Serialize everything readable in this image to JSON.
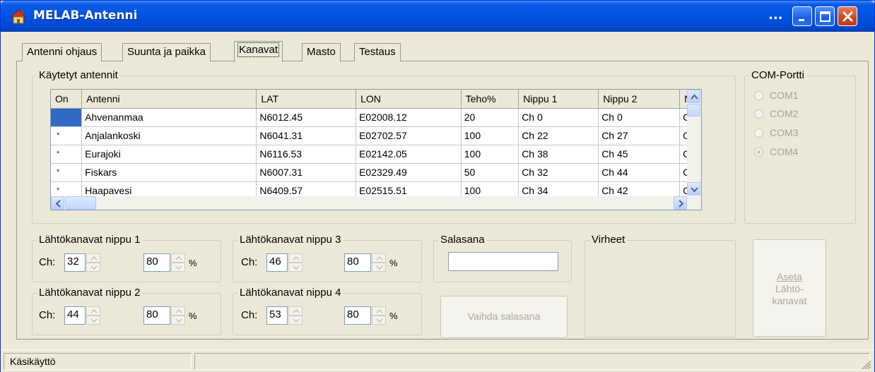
{
  "window": {
    "title": "MELAB-Antenni",
    "extra_button": "..."
  },
  "tabs": [
    {
      "label": "Antenni ohjaus"
    },
    {
      "label": "Suunta ja paikka"
    },
    {
      "label": "Kanavat"
    },
    {
      "label": "Masto"
    },
    {
      "label": "Testaus"
    }
  ],
  "active_tab": "Kanavat",
  "antennas": {
    "group_title": "Käytetyt antennit",
    "columns": [
      "On",
      "Antenni",
      "LAT",
      "LON",
      "Teho%",
      "Nippu 1",
      "Nippu 2",
      "N"
    ],
    "rows": [
      {
        "on": "",
        "name": "Ahvenanmaa",
        "lat": "N6012.45",
        "lon": "E02008.12",
        "teho": "20",
        "nippu1": "Ch 0",
        "nippu2": "Ch 0",
        "more": "C"
      },
      {
        "on": "*",
        "name": "Anjalankoski",
        "lat": "N6041.31",
        "lon": "E02702.57",
        "teho": "100",
        "nippu1": "Ch 22",
        "nippu2": "Ch 27",
        "more": "C"
      },
      {
        "on": "*",
        "name": "Eurajoki",
        "lat": "N6116.53",
        "lon": "E02142.05",
        "teho": "100",
        "nippu1": "Ch 38",
        "nippu2": "Ch 45",
        "more": "C"
      },
      {
        "on": "*",
        "name": "Fiskars",
        "lat": "N6007.31",
        "lon": "E02329.49",
        "teho": "50",
        "nippu1": "Ch 32",
        "nippu2": "Ch 44",
        "more": "C"
      },
      {
        "on": "*",
        "name": "Haapavesi",
        "lat": "N6409.57",
        "lon": "E02515.51",
        "teho": "100",
        "nippu1": "Ch 34",
        "nippu2": "Ch 42",
        "more": "C"
      }
    ]
  },
  "com_port": {
    "group_title": "COM-Portti",
    "options": [
      "COM1",
      "COM2",
      "COM3",
      "COM4"
    ],
    "selected": "COM4"
  },
  "outputs": {
    "ch_label": "Ch:",
    "pct_label": "%",
    "groups": [
      {
        "title": "Lähtökanavat nippu 1",
        "ch": "32",
        "power": "80"
      },
      {
        "title": "Lähtökanavat nippu 2",
        "ch": "44",
        "power": "80"
      },
      {
        "title": "Lähtökanavat nippu 3",
        "ch": "46",
        "power": "80"
      },
      {
        "title": "Lähtökanavat nippu 4",
        "ch": "53",
        "power": "80"
      }
    ]
  },
  "password": {
    "group_title": "Salasana",
    "value": "",
    "change_button": "Vaihda salasana"
  },
  "errors": {
    "group_title": "Virheet"
  },
  "set_button": {
    "line1": "Aseta",
    "line2": "Lähtö-",
    "line3": "kanavat"
  },
  "status": {
    "text": "Käsikäyttö"
  },
  "colors": {
    "titlebar": "#0053e1",
    "selection": "#316ac5",
    "face": "#ece9d8",
    "close": "#d3451f"
  }
}
